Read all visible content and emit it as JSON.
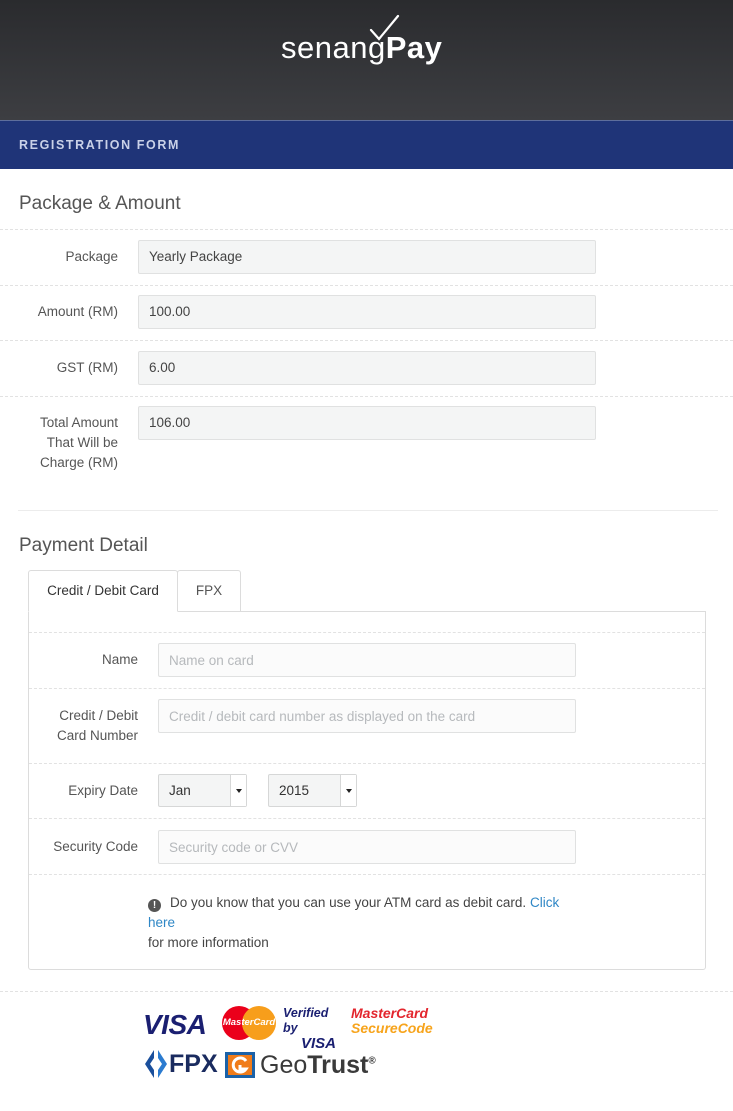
{
  "logo": {
    "light": "senang",
    "bold": "Pay"
  },
  "band": {
    "title": "REGISTRATION FORM"
  },
  "package_section": {
    "title": "Package & Amount",
    "package_label": "Package",
    "package_value": "Yearly Package",
    "amount_label": "Amount (RM)",
    "amount_value": "100.00",
    "gst_label": "GST (RM)",
    "gst_value": "6.00",
    "total_label_1": "Total Amount",
    "total_label_2": "That Will be",
    "total_label_3": "Charge (RM)",
    "total_value": "106.00"
  },
  "payment_section": {
    "title": "Payment Detail",
    "tabs": [
      {
        "label": "Credit / Debit Card"
      },
      {
        "label": "FPX"
      }
    ],
    "name_label": "Name",
    "name_placeholder": "Name on card",
    "card_label_1": "Credit / Debit",
    "card_label_2": "Card Number",
    "card_placeholder": "Credit / debit card number as displayed on the card",
    "expiry_label": "Expiry Date",
    "expiry_month": "Jan",
    "expiry_year": "2015",
    "security_label": "Security Code",
    "security_placeholder": "Security code or CVV",
    "info_icon": "!",
    "info_text": "Do you know that you can use your ATM card as debit card.",
    "info_link": "Click here",
    "info_text_2": "for more information"
  },
  "logos": {
    "visa": "VISA",
    "mastercard": "MasterCard",
    "verified_by": "Verified by",
    "verified_visa": "VISA",
    "securecode_1": "MasterCard",
    "securecode_2": "SecureCode",
    "fpx": "FPX",
    "geotrust_light": "Geo",
    "geotrust_bold": "Trust",
    "geotrust_mark": "®"
  },
  "colors": {
    "header_bg": "#2f3033",
    "band_bg": "#1f3478",
    "link": "#2f87c6"
  }
}
